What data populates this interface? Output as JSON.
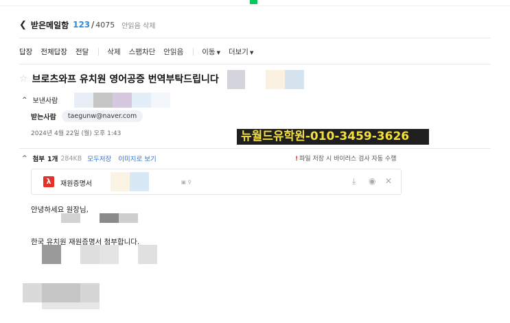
{
  "header": {
    "back_icon": "chevron-left-icon",
    "mailbox": "받은메일함",
    "unread": "123",
    "separator": "/",
    "total": "4075",
    "delete_unread": "안읽음 삭제"
  },
  "toolbar": {
    "reply": "답장",
    "reply_all": "전체답장",
    "forward": "전달",
    "delete": "삭제",
    "spam": "스팸차단",
    "mark_unread": "안읽음",
    "move": "이동",
    "more": "더보기"
  },
  "mail": {
    "subject": "브로츠와프 유치원 영어공증 번역부탁드립니다",
    "sender_label": "보낸사람",
    "recipient_label": "받는사람",
    "recipient_email": "taegunw@naver.com",
    "date": "2024년 4월 22일 (월) 오후 1:43"
  },
  "watermark": {
    "text": "뉴월드유학원-010-3459-3626",
    "color": "#f4df3b"
  },
  "attachment": {
    "label": "첨부",
    "count": "1개",
    "size": "284KB",
    "save_all": "모두저장",
    "view_as_image": "이미지로 보기",
    "virus_note": "파일 저장 시 바이러스 검사 자동 수행",
    "file_name": "재원증명서",
    "file_icon": "pdf-icon"
  },
  "body": {
    "greeting": "안녕하세요 원장님,",
    "message": "한국 유치원 재원증명서 첨부합니다."
  },
  "colors": {
    "accent": "#2d8ae0",
    "link": "#2d6fd0",
    "pdf": "#e4322b",
    "brand_green": "#03c75a"
  }
}
